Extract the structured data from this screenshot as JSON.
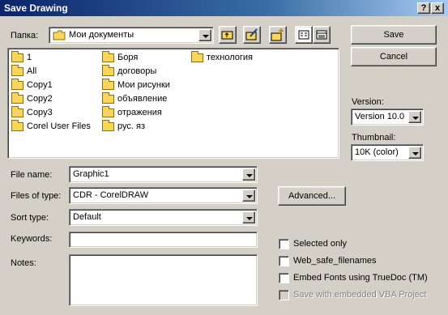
{
  "window": {
    "title": "Save Drawing",
    "help_label": "?",
    "close_label": "x"
  },
  "location": {
    "label": "Папка:",
    "value": "Мои документы"
  },
  "folders": [
    {
      "name": "1"
    },
    {
      "name": "All"
    },
    {
      "name": "Copy1"
    },
    {
      "name": "Copy2"
    },
    {
      "name": "Copy3"
    },
    {
      "name": "Corel User Files"
    },
    {
      "name": "Боря"
    },
    {
      "name": "договоры"
    },
    {
      "name": "Мои рисунки"
    },
    {
      "name": "объявление"
    },
    {
      "name": "отражения"
    },
    {
      "name": "рус. яз"
    },
    {
      "name": "технология"
    }
  ],
  "file_name": {
    "label": "File name:",
    "value": "Graphic1"
  },
  "file_type": {
    "label": "Files of type:",
    "value": "CDR - CorelDRAW"
  },
  "sort_type": {
    "label": "Sort type:",
    "value": "Default"
  },
  "keywords": {
    "label": "Keywords:",
    "value": ""
  },
  "notes": {
    "label": "Notes:",
    "value": ""
  },
  "buttons": {
    "save": "Save",
    "cancel": "Cancel",
    "advanced": "Advanced..."
  },
  "version": {
    "label": "Version:",
    "value": "Version 10.0"
  },
  "thumbnail": {
    "label": "Thumbnail:",
    "value": "10K (color)"
  },
  "options": {
    "selected_only": "Selected only",
    "web_safe": "Web_safe_filenames",
    "embed_fonts": "Embed Fonts using TrueDoc (TM)",
    "vba": "Save with embedded VBA Project"
  }
}
